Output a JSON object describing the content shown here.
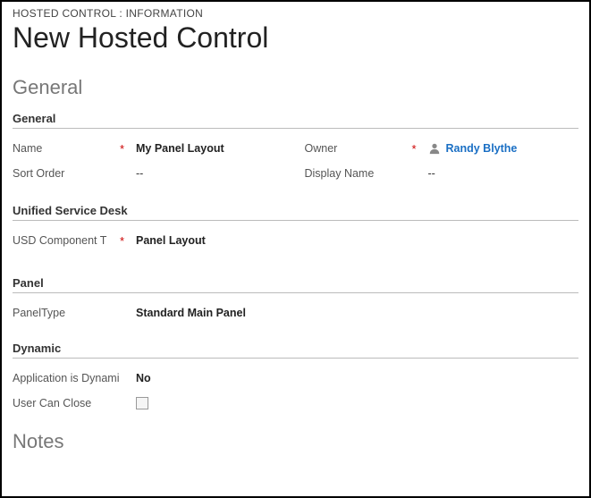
{
  "breadcrumb": "HOSTED CONTROL : INFORMATION",
  "page_title": "New Hosted Control",
  "sections": {
    "general_title": "General",
    "notes_title": "Notes"
  },
  "subsections": {
    "general": "General",
    "usd": "Unified Service Desk",
    "panel": "Panel",
    "dynamic": "Dynamic"
  },
  "labels": {
    "name": "Name",
    "sort_order": "Sort Order",
    "owner": "Owner",
    "display_name": "Display Name",
    "usd_component": "USD Component T",
    "panel_type": "PanelType",
    "app_is_dynamic": "Application is Dynami",
    "user_can_close": "User Can Close"
  },
  "required_marker": "*",
  "values": {
    "name": "My Panel Layout",
    "sort_order": "--",
    "owner": "Randy Blythe",
    "display_name": "--",
    "usd_component": "Panel Layout",
    "panel_type": "Standard Main Panel",
    "app_is_dynamic": "No"
  }
}
